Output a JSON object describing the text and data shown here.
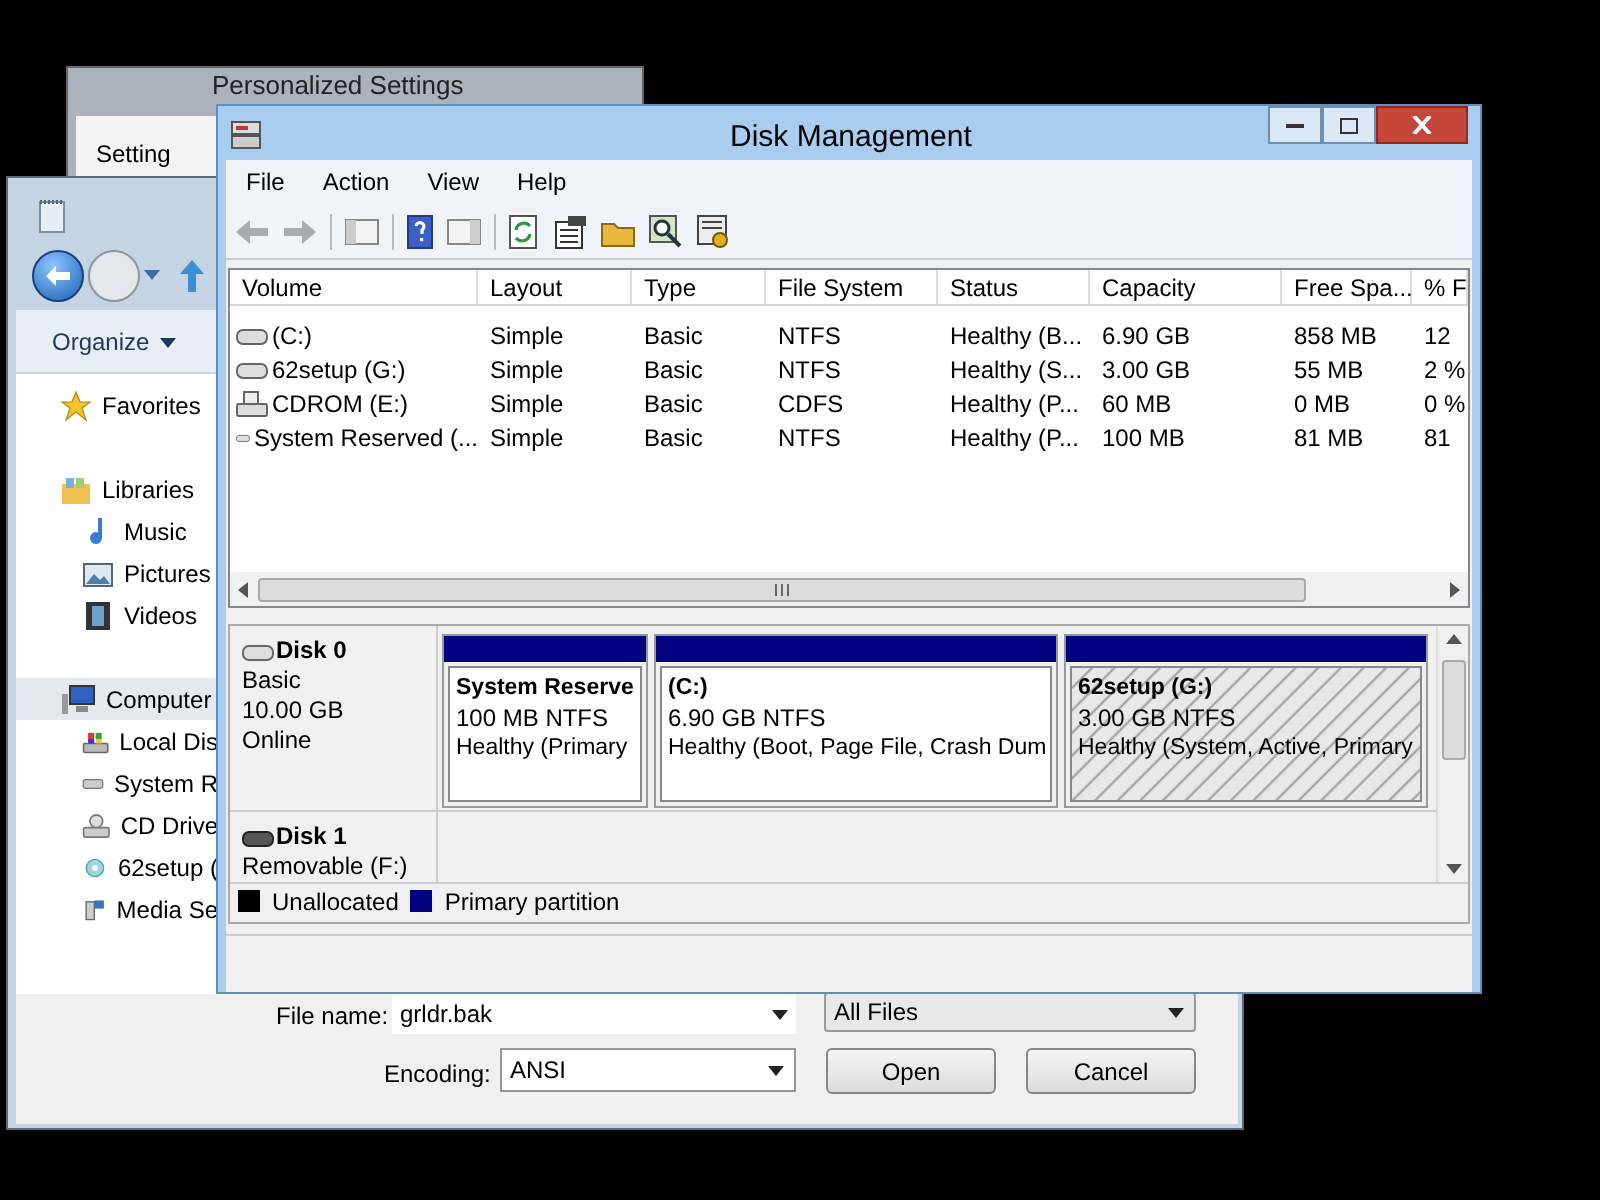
{
  "back_window": {
    "title": "Personalized Settings",
    "label": "Setting"
  },
  "open_dialog": {
    "organize": "Organize",
    "sidebar": [
      {
        "label": "Favorites",
        "kind": "favorites",
        "selected": false
      },
      {
        "label": "Libraries",
        "kind": "library",
        "selected": false,
        "children": [
          {
            "label": "Music",
            "kind": "music",
            "selected": false
          },
          {
            "label": "Pictures",
            "kind": "pictures",
            "selected": false
          },
          {
            "label": "Videos",
            "kind": "videos",
            "selected": false
          }
        ]
      },
      {
        "label": "Computer",
        "kind": "computer",
        "selected": true,
        "children": [
          {
            "label": "Local Dis",
            "kind": "system-drive",
            "selected": false
          },
          {
            "label": "System R",
            "kind": "drive",
            "selected": false
          },
          {
            "label": "CD Drive",
            "kind": "cd",
            "selected": false
          },
          {
            "label": "62setup (",
            "kind": "setup",
            "selected": false
          },
          {
            "label": "Media Se",
            "kind": "media",
            "selected": false
          }
        ]
      }
    ],
    "file_name": {
      "label": "File name:",
      "value": "grldr.bak"
    },
    "file_type": "All Files",
    "encoding": {
      "label": "Encoding:",
      "value": "ANSI"
    },
    "buttons": [
      "Open",
      "Cancel"
    ]
  },
  "disk_management": {
    "title": "Disk Management",
    "menu": [
      "File",
      "Action",
      "View",
      "Help"
    ],
    "volumes": {
      "columns": [
        "Volume",
        "Layout",
        "Type",
        "File System",
        "Status",
        "Capacity",
        "Free Spa...",
        "% F"
      ],
      "rows": [
        {
          "kind": "hdd",
          "cells": [
            "(C:)",
            "Simple",
            "Basic",
            "NTFS",
            "Healthy (B...",
            "6.90 GB",
            "858 MB",
            "12"
          ]
        },
        {
          "kind": "hdd",
          "cells": [
            "62setup (G:)",
            "Simple",
            "Basic",
            "NTFS",
            "Healthy (S...",
            "3.00 GB",
            "55 MB",
            "2 %"
          ]
        },
        {
          "kind": "cd",
          "cells": [
            "CDROM (E:)",
            "Simple",
            "Basic",
            "CDFS",
            "Healthy (P...",
            "60 MB",
            "0 MB",
            "0 %"
          ]
        },
        {
          "kind": "hdd",
          "cells": [
            "System Reserved (...",
            "Simple",
            "Basic",
            "NTFS",
            "Healthy (P...",
            "100 MB",
            "81 MB",
            "81"
          ]
        }
      ]
    },
    "disks": [
      {
        "name": "Disk 0",
        "kind": "hdd",
        "details": [
          "Basic",
          "10.00 GB",
          "Online"
        ],
        "partitions": [
          {
            "name": "System Reserve",
            "size": "100 MB NTFS",
            "status": "Healthy (Primary",
            "selected": false
          },
          {
            "name": "(C:)",
            "size": "6.90 GB NTFS",
            "status": "Healthy (Boot, Page File, Crash Dum",
            "selected": false
          },
          {
            "name": "62setup  (G:)",
            "size": "3.00 GB NTFS",
            "status": "Healthy (System, Active, Primary",
            "selected": true
          }
        ]
      },
      {
        "name": "Disk 1",
        "kind": "removable",
        "details": [
          "Removable (F:)"
        ]
      }
    ],
    "legend": [
      {
        "label": "Unallocated",
        "color": "#000000"
      },
      {
        "label": "Primary partition",
        "color": "#000080"
      }
    ]
  }
}
